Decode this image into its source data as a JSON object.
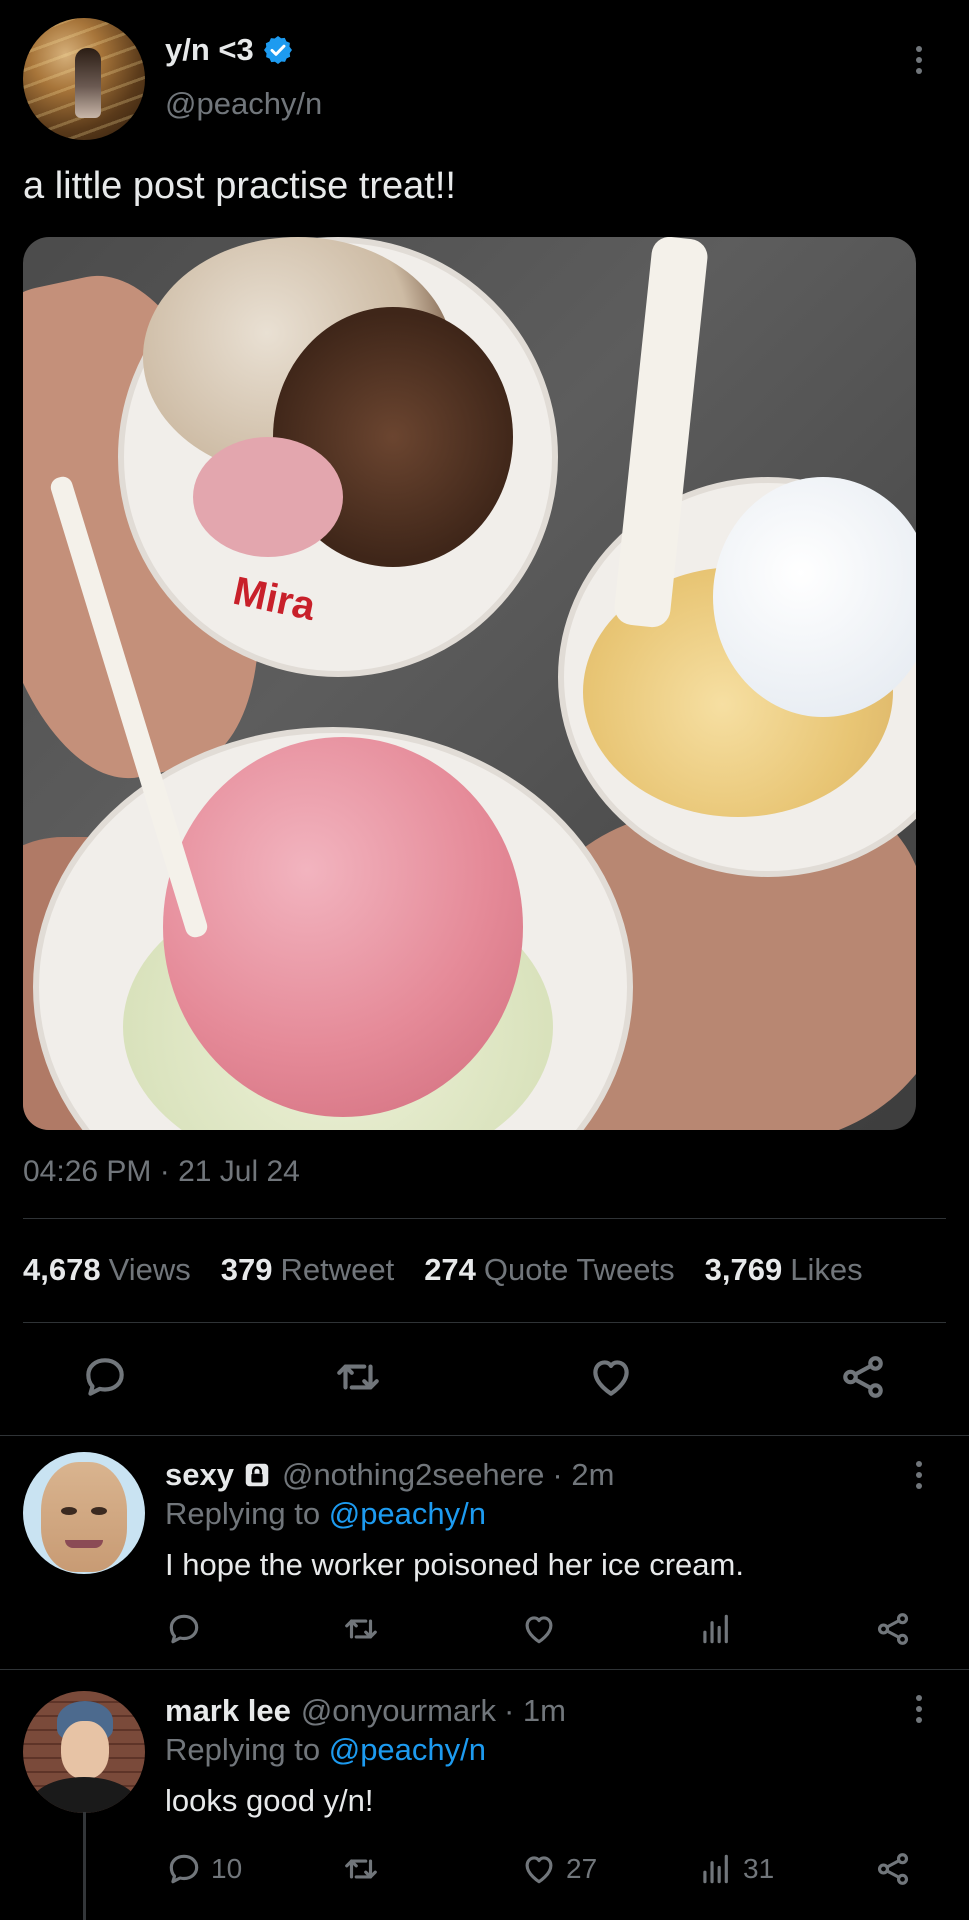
{
  "post": {
    "display_name": "y/n <3",
    "handle": "@peachy/n",
    "text": "a little post practise treat!!",
    "timestamp": "04:26 PM · 21 Jul 24",
    "media_cup_brand": "Mira",
    "stats": {
      "views": "4,678",
      "views_label": "Views",
      "retweets": "379",
      "retweets_label": "Retweet",
      "quotes": "274",
      "quotes_label": "Quote Tweets",
      "likes": "3,769",
      "likes_label": "Likes"
    }
  },
  "replies": [
    {
      "name": "sexy",
      "handle": "@nothing2seehere",
      "time": "· 2m",
      "replying_prefix": "Replying to",
      "replying_to": "@peachy/n",
      "text": "I hope the worker poisoned her ice cream.",
      "reply_count": "",
      "like_count": "",
      "view_count": ""
    },
    {
      "name": "mark lee",
      "handle": "@onyourmark",
      "time": "· 1m",
      "replying_prefix": "Replying to",
      "replying_to": "@peachy/n",
      "text": "looks good y/n!",
      "reply_count": "10",
      "like_count": "27",
      "view_count": "31"
    }
  ],
  "colors": {
    "background": "#000000",
    "text": "#e7e9ea",
    "muted": "#71767b",
    "accent": "#1d9bf0",
    "divider": "#2f3336"
  },
  "icons": [
    "verified-badge-icon",
    "more-vertical-icon",
    "reply-icon",
    "retweet-icon",
    "like-icon",
    "share-icon",
    "views-icon",
    "lock-icon"
  ]
}
